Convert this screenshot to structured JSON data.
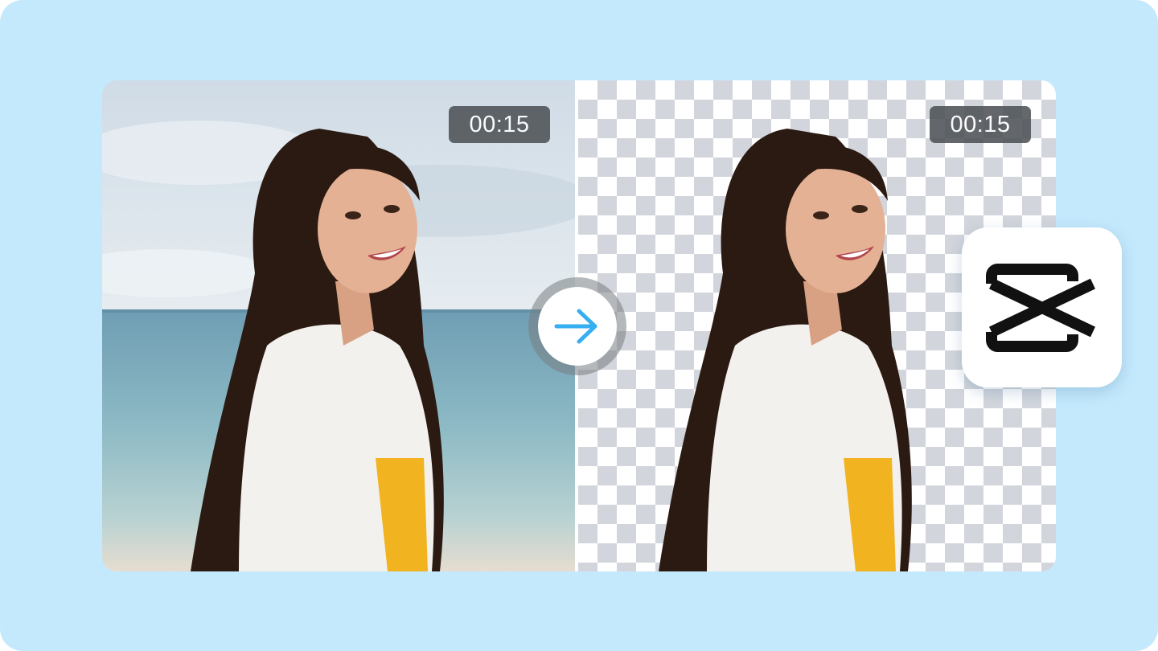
{
  "colors": {
    "background": "#c4e9fd",
    "accent_arrow": "#35aef2",
    "badge_bg": "#4e5357",
    "logo_tile_bg": "#ffffff",
    "logo_mark": "#111111"
  },
  "left_panel": {
    "timestamp": "00:15",
    "image": "woman-on-beach-photo"
  },
  "right_panel": {
    "timestamp": "00:15",
    "image": "woman-background-removed-cutout",
    "background": "transparency-checkerboard"
  },
  "arrow_button": {
    "icon": "arrow-right-icon"
  },
  "logo": {
    "icon": "capcut-logo-icon"
  }
}
